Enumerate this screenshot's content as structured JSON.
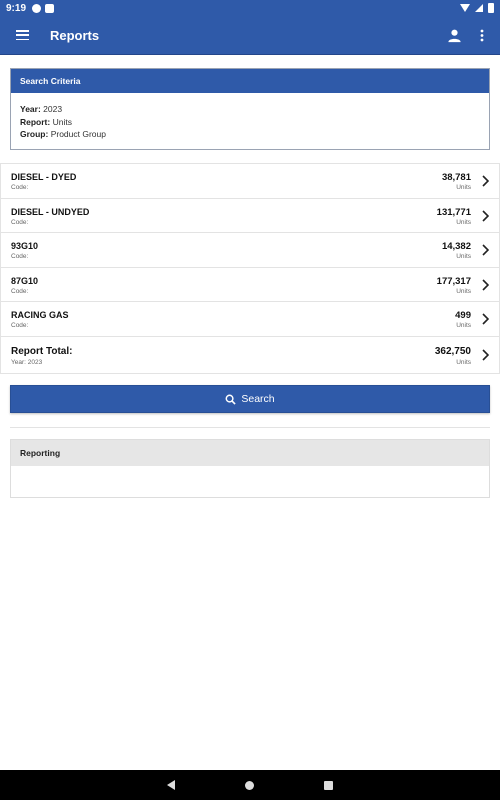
{
  "status_bar": {
    "time": "9:19"
  },
  "app_bar": {
    "title": "Reports"
  },
  "criteria": {
    "header": "Search Criteria",
    "year_label": "Year:",
    "year_value": "2023",
    "report_label": "Report:",
    "report_value": "Units",
    "group_label": "Group:",
    "group_value": "Product Group"
  },
  "rows": [
    {
      "name": "DIESEL - DYED",
      "code": "Code:",
      "value": "38,781",
      "unit": "Units"
    },
    {
      "name": "DIESEL - UNDYED",
      "code": "Code:",
      "value": "131,771",
      "unit": "Units"
    },
    {
      "name": "93G10",
      "code": "Code:",
      "value": "14,382",
      "unit": "Units"
    },
    {
      "name": "87G10",
      "code": "Code:",
      "value": "177,317",
      "unit": "Units"
    },
    {
      "name": "RACING GAS",
      "code": "Code:",
      "value": "499",
      "unit": "Units"
    }
  ],
  "total": {
    "label": "Report Total:",
    "sub": "Year: 2023",
    "value": "362,750",
    "unit": "Units"
  },
  "search_button": {
    "label": "Search"
  },
  "reporting": {
    "header": "Reporting"
  },
  "colors": {
    "primary": "#2f5aa9",
    "panel_header": "#e6e6e6"
  }
}
